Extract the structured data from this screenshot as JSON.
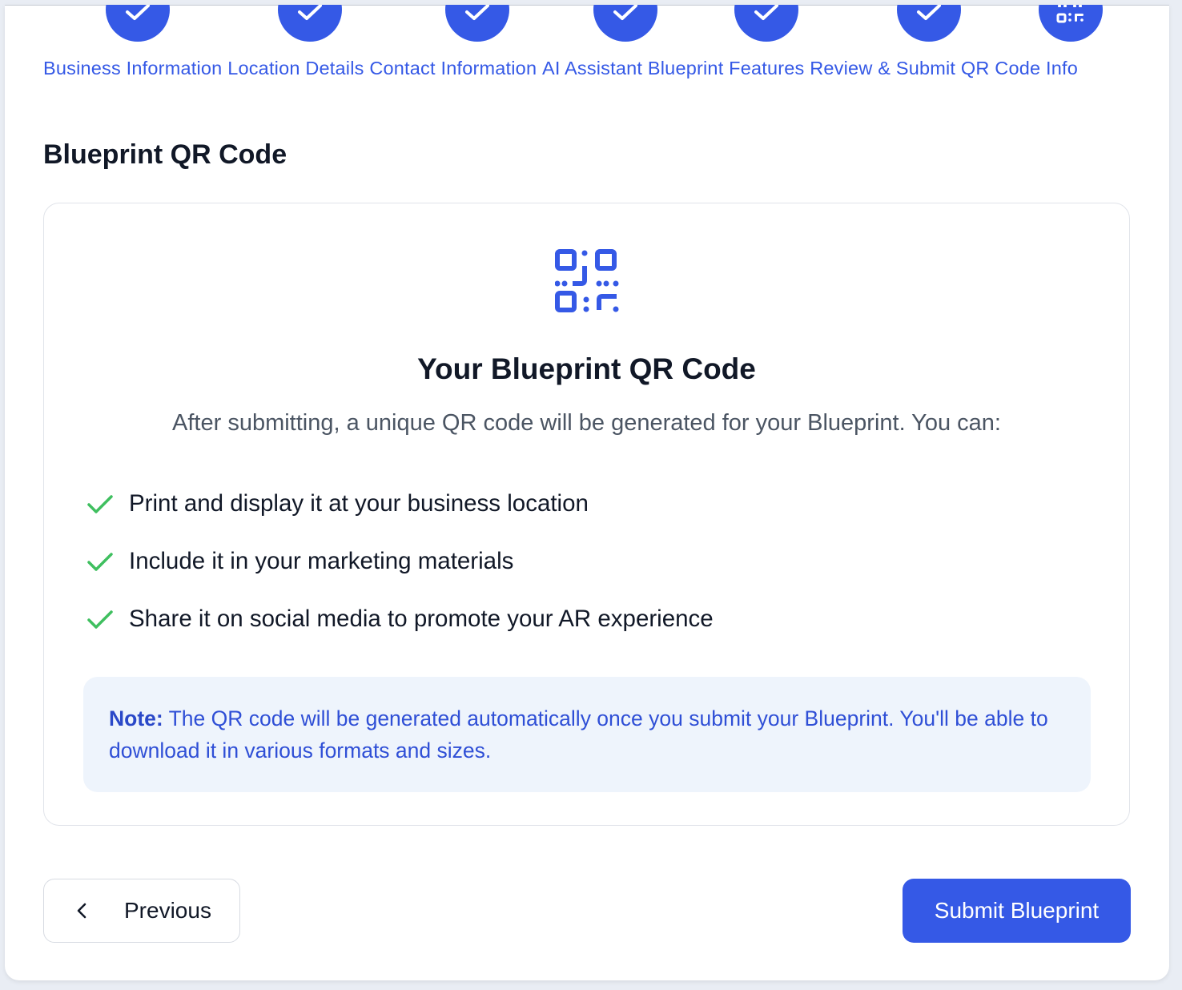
{
  "stepper": {
    "steps": [
      {
        "label": "Business Information",
        "icon": "check-icon",
        "status": "complete"
      },
      {
        "label": "Location Details",
        "icon": "check-icon",
        "status": "complete"
      },
      {
        "label": "Contact Information",
        "icon": "check-icon",
        "status": "complete"
      },
      {
        "label": "AI Assistant",
        "icon": "check-icon",
        "status": "complete"
      },
      {
        "label": "Blueprint Features",
        "icon": "check-icon",
        "status": "complete"
      },
      {
        "label": "Review & Submit",
        "icon": "check-icon",
        "status": "complete"
      },
      {
        "label": "QR Code Info",
        "icon": "qr-code-icon",
        "status": "current"
      }
    ]
  },
  "section": {
    "title": "Blueprint QR Code"
  },
  "card": {
    "icon": "qr-code-icon",
    "title": "Your Blueprint QR Code",
    "description": "After submitting, a unique QR code will be generated for your Blueprint. You can:",
    "benefits": [
      "Print and display it at your business location",
      "Include it in your marketing materials",
      "Share it on social media to promote your AR experience"
    ],
    "note": {
      "label": "Note:",
      "text": "The QR code will be generated automatically once you submit your Blueprint. You'll be able to download it in various formats and sizes."
    }
  },
  "actions": {
    "previous_label": "Previous",
    "submit_label": "Submit Blueprint"
  },
  "colors": {
    "accent": "#3559e6",
    "check_green": "#3fbf5f",
    "note_bg": "#eef4fc"
  }
}
